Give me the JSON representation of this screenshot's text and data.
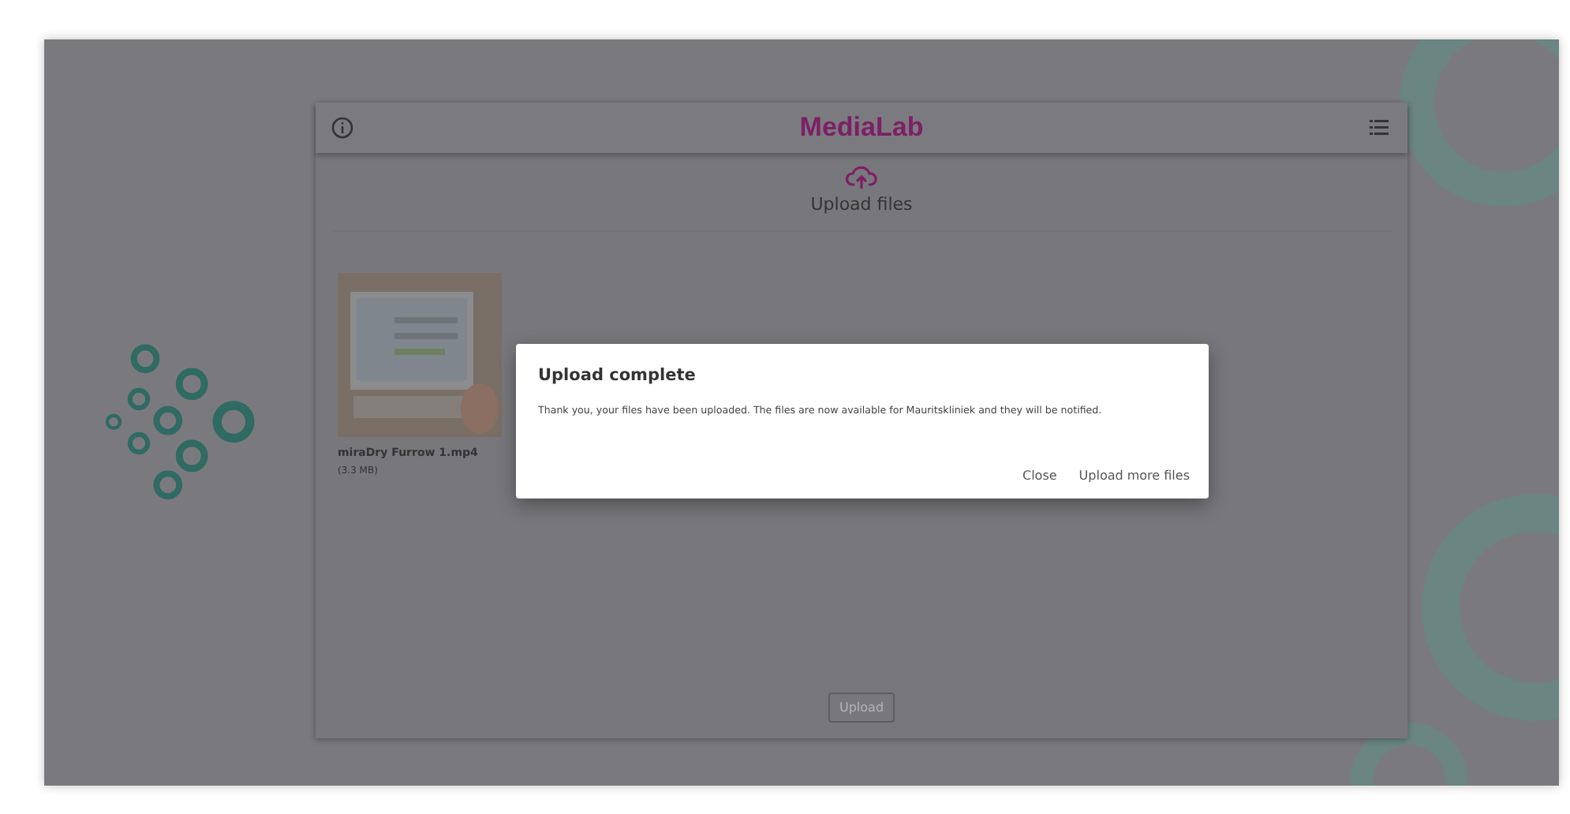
{
  "header": {
    "title": "MediaLab"
  },
  "upload_area": {
    "label": "Upload files"
  },
  "files": [
    {
      "name": "miraDry Furrow 1.mp4",
      "size": "(3.3 MB)",
      "kind": "picture"
    }
  ],
  "upload_button": {
    "label": "Upload",
    "disabled": true
  },
  "dialog": {
    "title": "Upload complete",
    "message": "Thank you, your files have been uploaded. The files are now available for Mauritskliniek and they will be notified.",
    "buttons": [
      {
        "label": "Close"
      },
      {
        "label": "Upload more files"
      }
    ]
  }
}
